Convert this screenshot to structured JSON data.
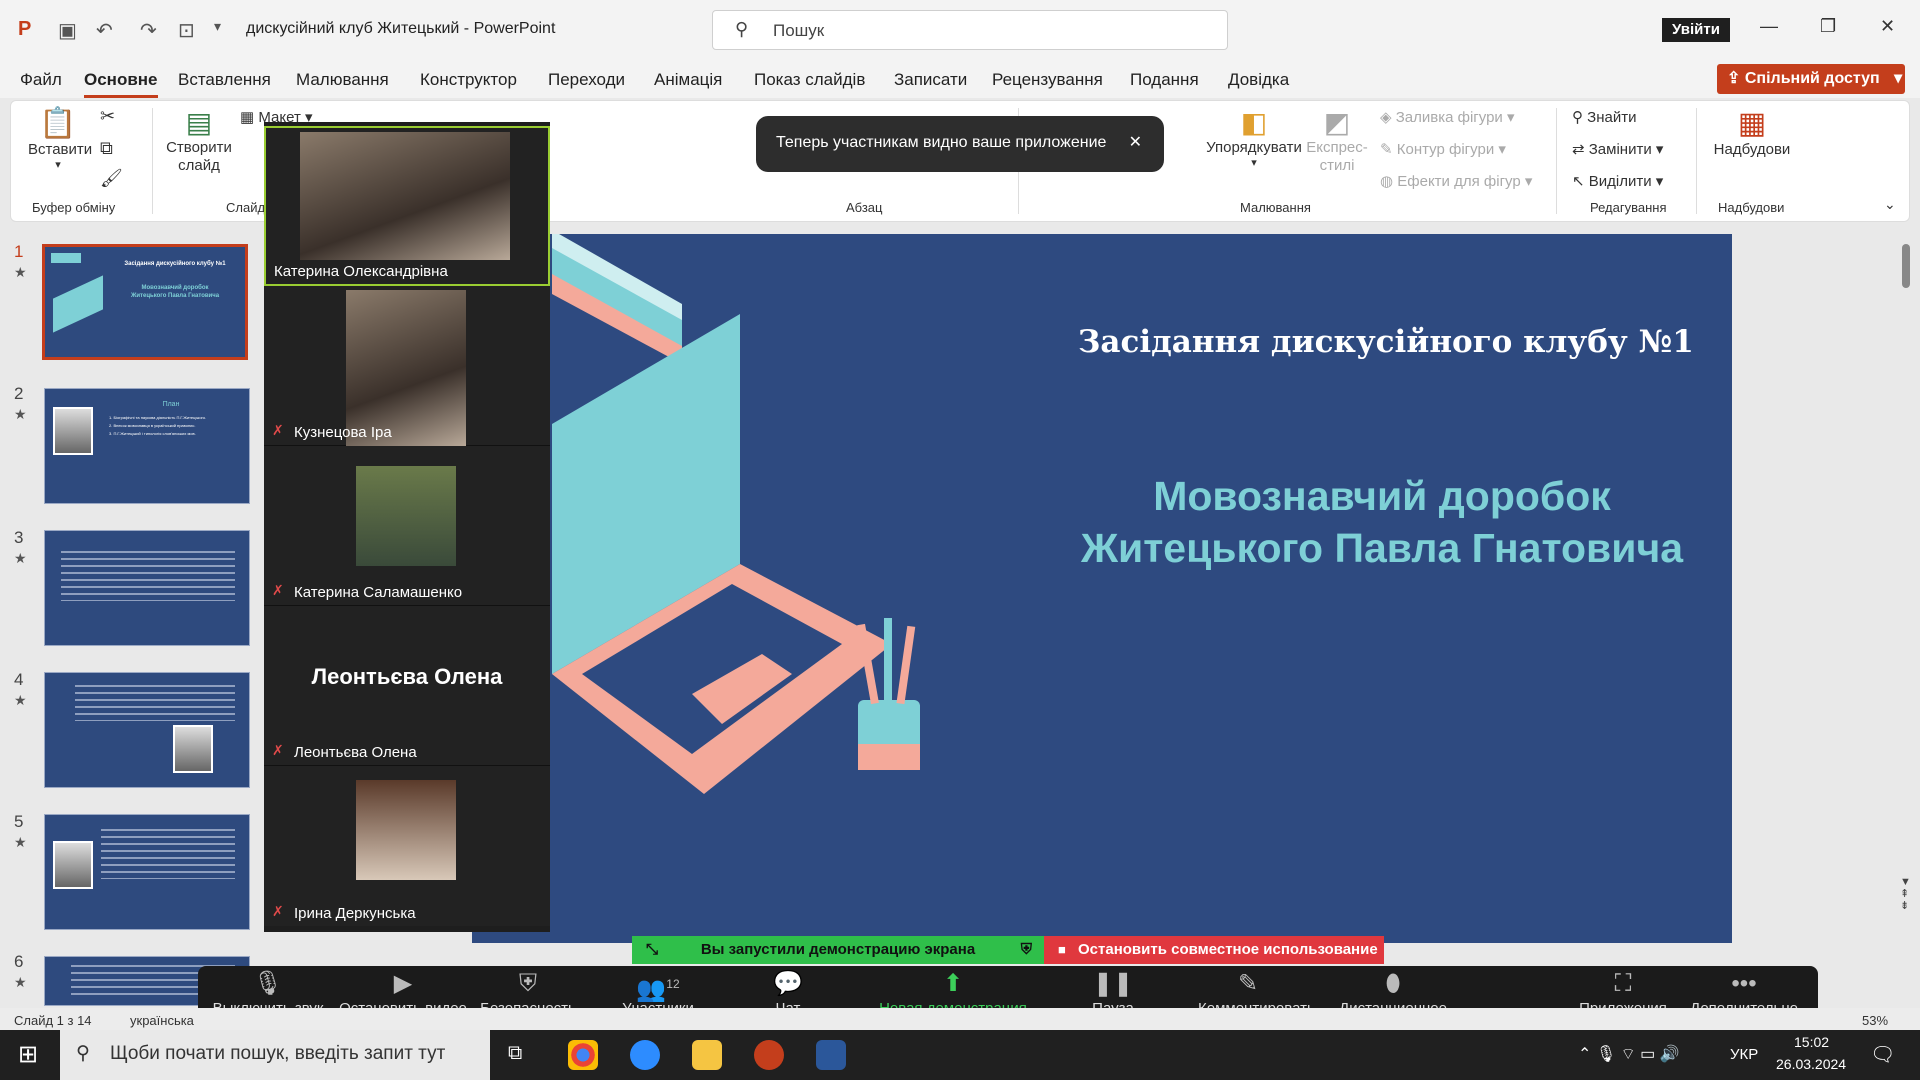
{
  "app": {
    "doc_title": "дискусійний клуб Житецький  -  PowerPoint",
    "search_placeholder": "Пошук",
    "signin": "Увійти"
  },
  "menu": [
    "Файл",
    "Основне",
    "Вставлення",
    "Малювання",
    "Конструктор",
    "Переходи",
    "Анімація",
    "Показ слайдів",
    "Записати",
    "Рецензування",
    "Подання",
    "Довідка"
  ],
  "share_button": "Спільний доступ",
  "ribbon": {
    "paste": "Вставити",
    "new_slide": "Створити слайд",
    "layout": "Макет",
    "arrange": "Упорядкувати",
    "quick_styles": "Експрес-стилі",
    "shape_fill": "Заливка фігури",
    "shape_outline": "Контур фігури",
    "shape_effects": "Ефекти для фігур",
    "find": "Знайти",
    "replace": "Замінити",
    "select": "Виділити",
    "addins": "Надбудови",
    "groups": {
      "clipboard": "Буфер обміну",
      "slides": "Слайд",
      "paragraph": "Абзац",
      "drawing": "Малювання",
      "editing": "Редагування",
      "addins": "Надбудови"
    }
  },
  "toast": "Теперь участникам видно ваше приложение",
  "participants": [
    {
      "name": "Катерина Олександрівна",
      "muted": false
    },
    {
      "name": "Кузнецова Іра",
      "muted": true
    },
    {
      "name": "Катерина Саламашенко",
      "muted": true
    },
    {
      "name": "Леонтьєва Олена",
      "muted": true,
      "avatar_text": "Леонтьєва Олена"
    },
    {
      "name": "Ірина Деркунська",
      "muted": true
    }
  ],
  "thumbnails": [
    "1",
    "2",
    "3",
    "4",
    "5",
    "6"
  ],
  "slide": {
    "title": "Засідання дискусійного клубу №1",
    "subtitle_line1": "Мовознавчий доробок",
    "subtitle_line2": "Житецького Павла Гнатовича"
  },
  "thumb1": {
    "title": "Засідання дискусійного клубу №1",
    "sub1": "Мовознавчий доробок",
    "sub2": "Житецького Павла Гнатовича"
  },
  "thumb2": {
    "title": "План",
    "l1": "1. Біографічні та наукова діяльність П.Г.Житецького.",
    "l2": "2. Внесок мовознавця в український правопис.",
    "l3": "3. П.Г.Житецький і типологія слов'янських мов."
  },
  "zoom": {
    "sharing": "Вы запустили демонстрацию экрана",
    "stop": "Остановить совместное использование",
    "buttons": [
      "Выключить звук",
      "Остановить видео",
      "Безопасность",
      "Участники",
      "Чат",
      "Новая демонстрация",
      "Пауза демонстрации",
      "Комментировать",
      "Дистанционное управление",
      "Приложения",
      "Дополнительно"
    ],
    "participants_count": "12"
  },
  "status": {
    "slide": "Слайд 1 з 14",
    "lang": "українська",
    "zoom": "53%"
  },
  "taskbar": {
    "search": "Щоби почати пошук, введіть запит тут",
    "time": "15:02",
    "date": "26.03.2024",
    "lang": "УКР"
  },
  "colors": {
    "accent": "#c43e1c",
    "slide_bg": "#2e4a80",
    "slide_sub": "#7ed0d6",
    "zoom_green": "#2fbf4a",
    "zoom_red": "#e0383e"
  }
}
